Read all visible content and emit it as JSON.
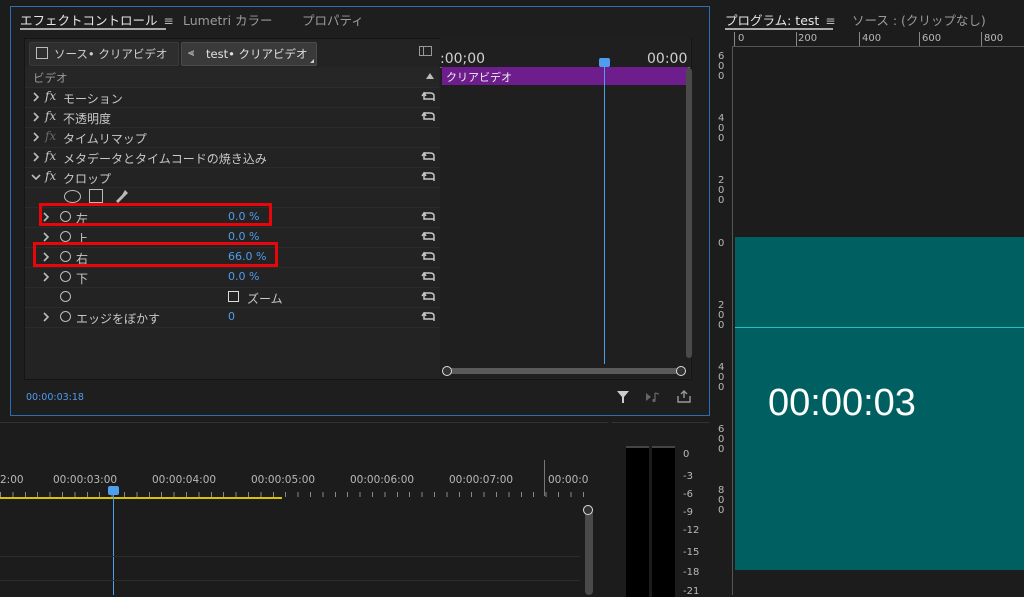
{
  "effect_panel": {
    "tabs": [
      {
        "label": "エフェクトコントロール",
        "menu": "≡"
      },
      {
        "label": "Lumetri カラー"
      },
      {
        "label": "プロパティ"
      }
    ],
    "source_button": "ソース• クリアビデオ",
    "seq_button": "test• クリアビデオ",
    "section_label": "ビデオ",
    "timecode_start": ":00;00",
    "timecode_end": "00:00",
    "clip_label": "クリアビデオ",
    "current_time": "00:00:03:18",
    "effects": [
      {
        "label": "モーション"
      },
      {
        "label": "不透明度"
      },
      {
        "label": "タイムリマップ"
      },
      {
        "label": "メタデータとタイムコードの焼き込み"
      },
      {
        "label": "クロップ"
      }
    ],
    "crop_params": [
      {
        "label": "左",
        "value": "0.0 %"
      },
      {
        "label": "上",
        "value": "0.0 %"
      },
      {
        "label": "右",
        "value": "66.0 %"
      },
      {
        "label": "下",
        "value": "0.0 %"
      },
      {
        "label": "",
        "zoom_label": "ズーム"
      },
      {
        "label": "エッジをぼかす",
        "value": "0"
      }
    ]
  },
  "program_panel": {
    "tab_active": "プログラム: test",
    "menu": "≡",
    "tab_other": "ソース : (クリップなし)",
    "ruler": [
      "0",
      "200",
      "400",
      "600",
      "800"
    ],
    "vruler": [
      "600",
      "400",
      "200",
      "0",
      "200",
      "400",
      "600",
      "800"
    ],
    "timecode_overlay": "00:00:03"
  },
  "timeline": {
    "times": [
      "2:00",
      "00:00:03:00",
      "00:00:04:00",
      "00:00:05:00",
      "00:00:06:00",
      "00:00:07:00",
      "00:00:0"
    ]
  },
  "audio_meter": {
    "labels": [
      "0",
      "-3",
      "-6",
      "-9",
      "-12",
      "-15",
      "-18",
      "-21"
    ]
  },
  "colors": {
    "accent": "#4f9ded",
    "clip": "#6e1e8c",
    "highlight": "#e8060b",
    "video": "#006061",
    "guide": "#1fc3c3"
  }
}
